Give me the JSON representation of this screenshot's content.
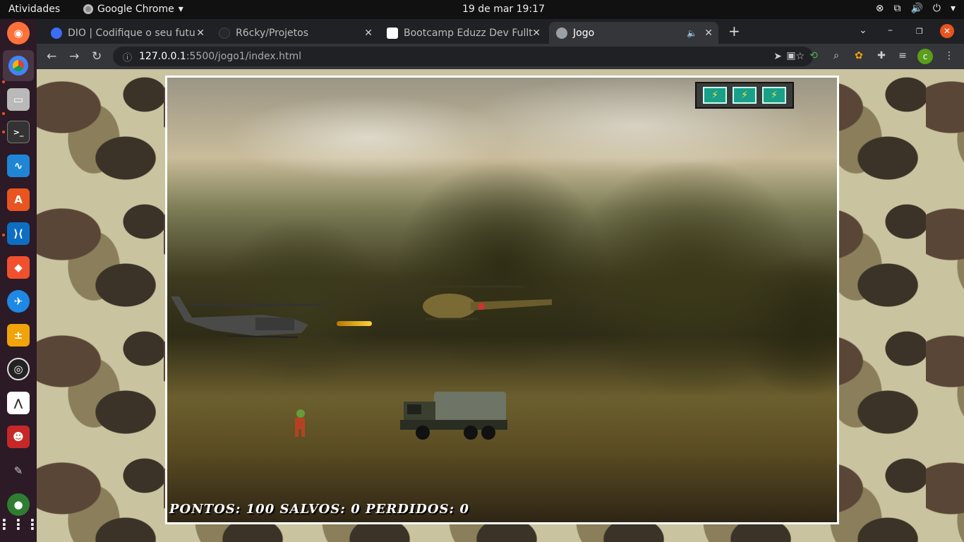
{
  "topbar": {
    "activities": "Atividades",
    "app_name": "Google Chrome",
    "clock": "19 de mar  19:17"
  },
  "tabs": [
    {
      "title": "DIO | Codifique o seu futu",
      "favicon_color": "#3b6df5"
    },
    {
      "title": "R6cky/Projetos",
      "favicon_color": "#24292e"
    },
    {
      "title": "Bootcamp Eduzz Dev Fullt",
      "favicon_color": "#ffffff"
    },
    {
      "title": "Jogo",
      "favicon_color": "#9aa0a6"
    }
  ],
  "toolbar": {
    "url_host": "127.0.0.1",
    "url_path": ":5500/jogo1/index.html",
    "profile_initial": "c"
  },
  "game": {
    "score_label": "PONTOS: 100 SALVOS: 0 PERDIDOS: 0",
    "energy_cells": 3
  },
  "colors": {
    "accent": "#e95420",
    "chrome_dark": "#202124",
    "chrome_toolbar": "#35363a",
    "close_button": "#e95420"
  }
}
